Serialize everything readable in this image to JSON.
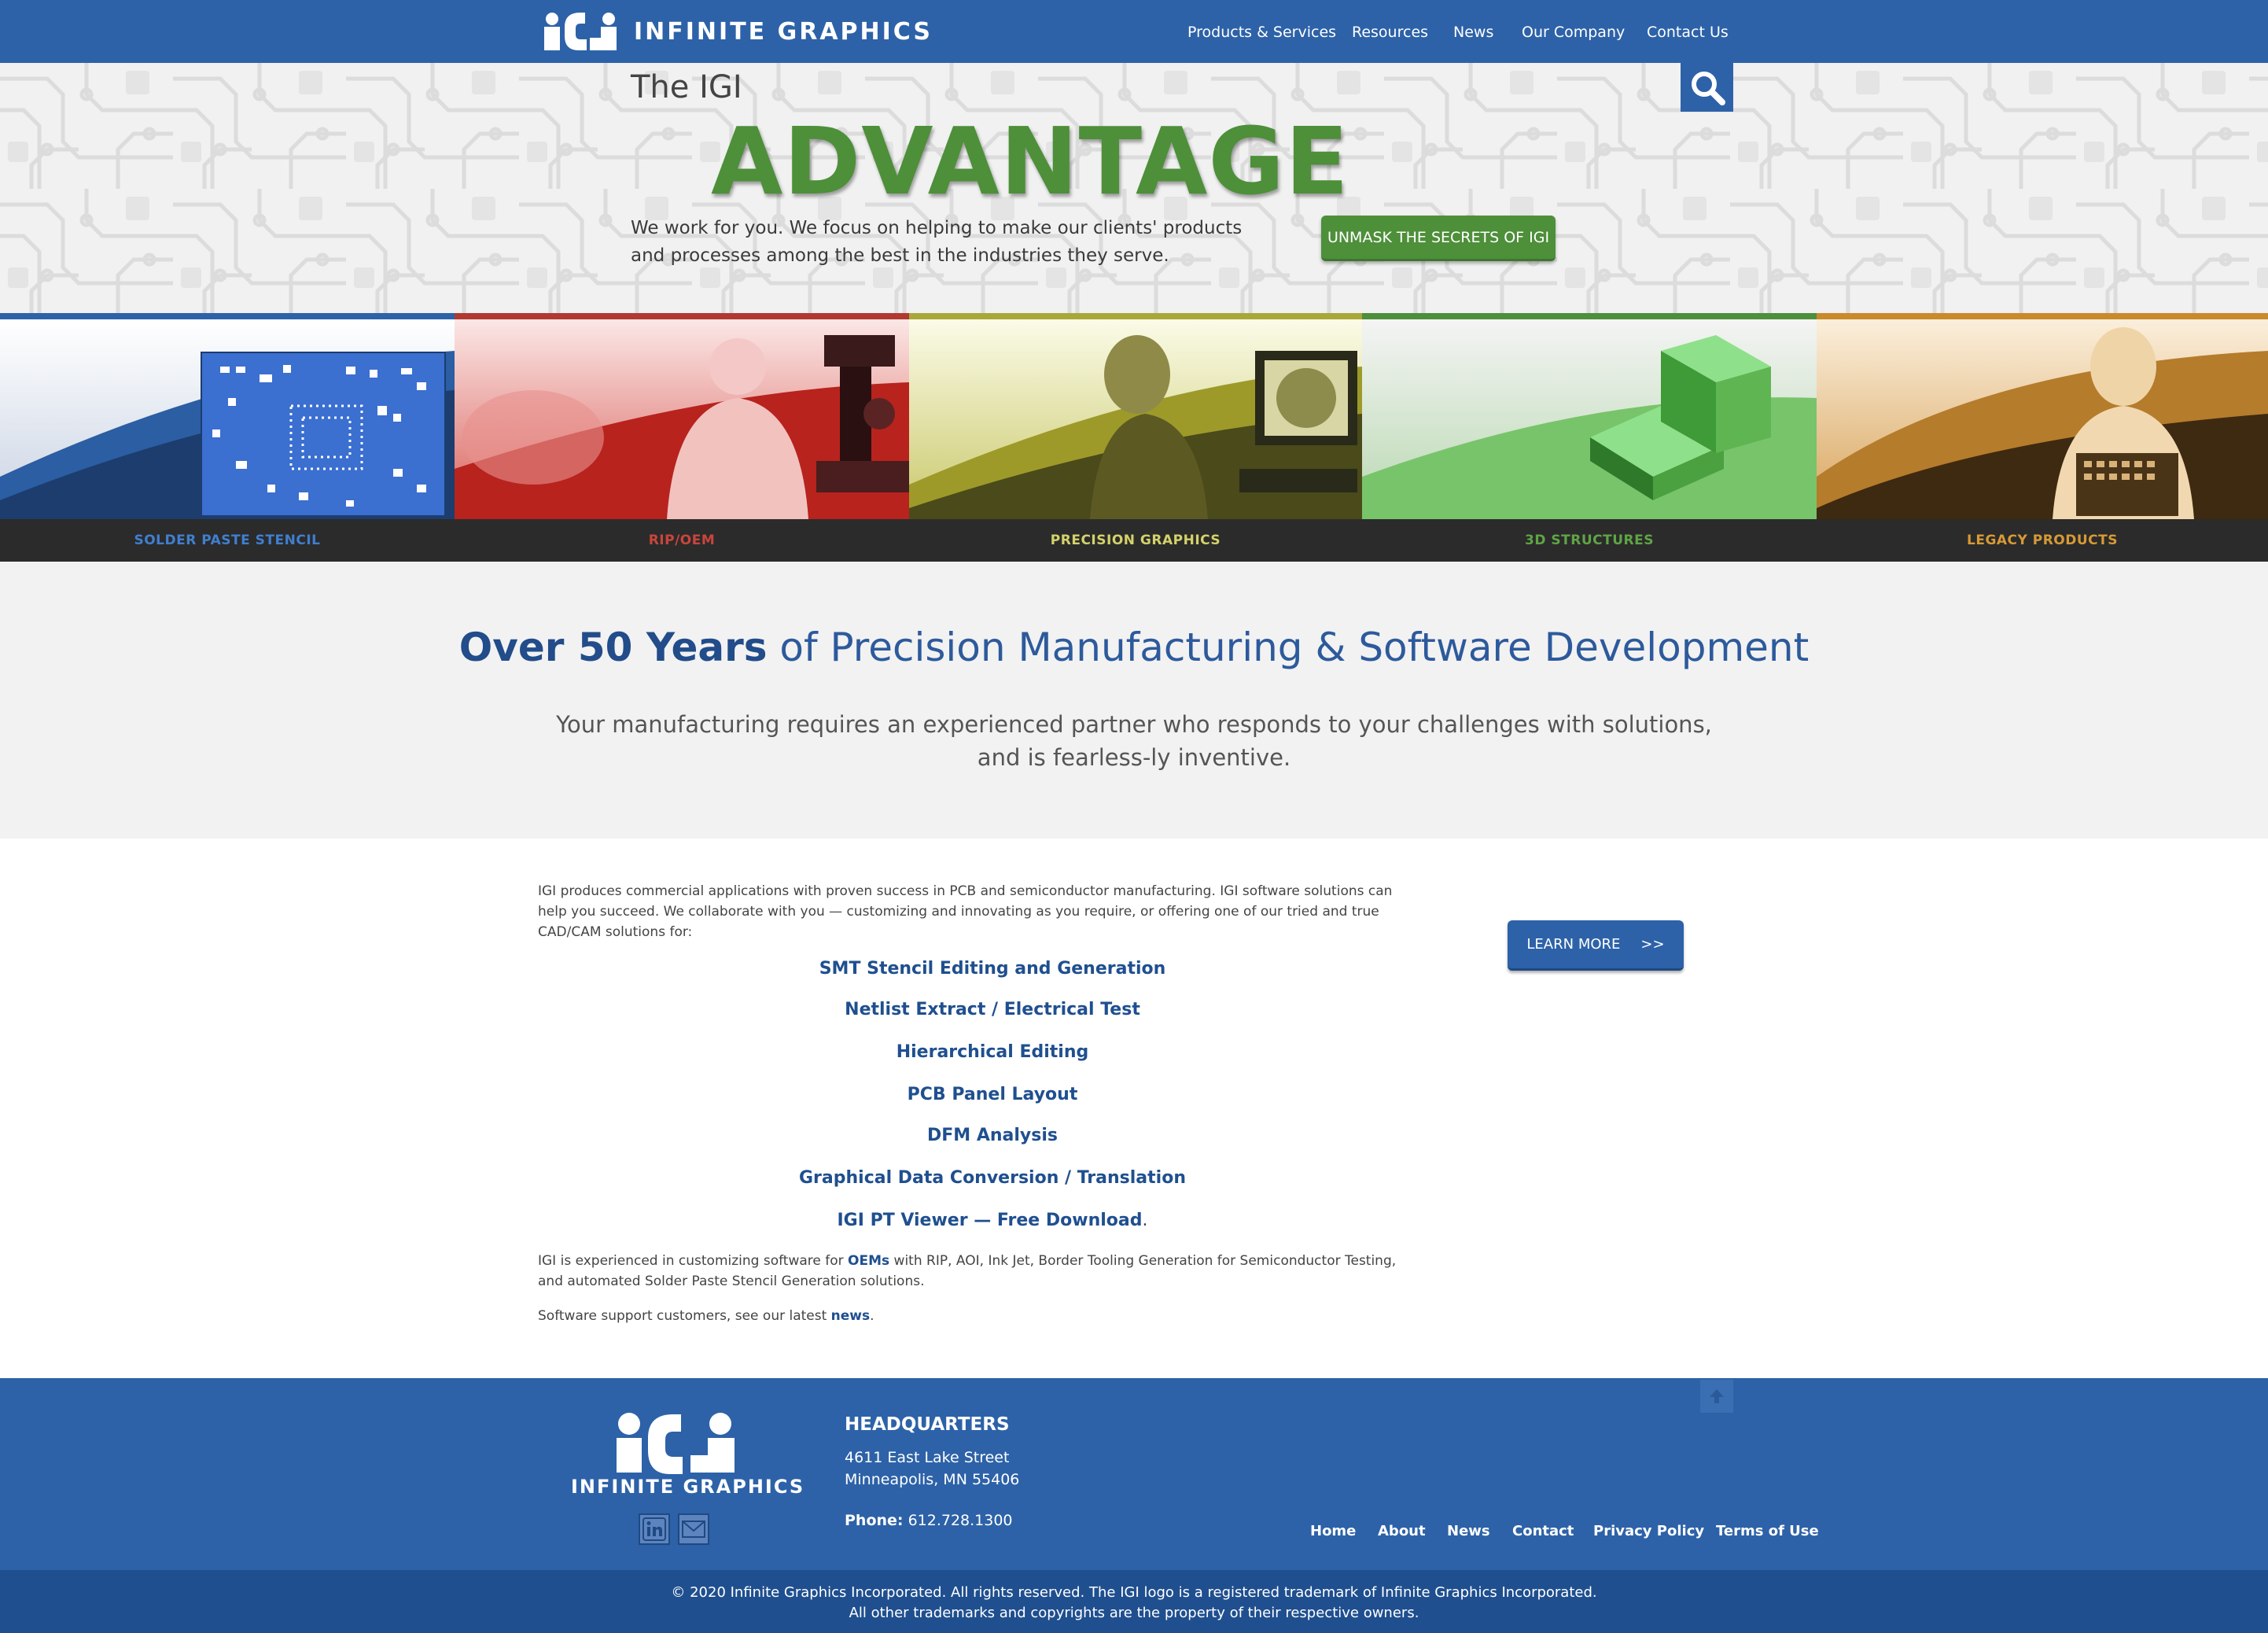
{
  "header": {
    "logo_text": "INFINITE GRAPHICS",
    "nav": [
      "Products & Services",
      "Resources",
      "News",
      "Our Company",
      "Contact Us"
    ]
  },
  "hero": {
    "small_title": "The IGI",
    "big_title": "ADVANTAGE",
    "copy": "We work for you. We focus on helping to make our clients' products and processes among the best in the industries they serve.",
    "button": "UNMASK THE SECRETS OF IGI",
    "search_icon": "search-icon"
  },
  "categories": [
    {
      "label": "SOLDER PASTE STENCIL",
      "color": "#2d62a8",
      "label_color": "#3f7fd0"
    },
    {
      "label": "RIP/OEM",
      "color": "#b03a32",
      "label_color": "#c9453c"
    },
    {
      "label": "PRECISION GRAPHICS",
      "color": "#a8a83a",
      "label_color": "#d4d26a"
    },
    {
      "label": "3D STRUCTURES",
      "color": "#4e8f3a",
      "label_color": "#5fa446"
    },
    {
      "label": "LEGACY PRODUCTS",
      "color": "#c98a2b",
      "label_color": "#d79a35"
    }
  ],
  "intro": {
    "heading_bold": "Over 50 Years",
    "heading_rest": " of Precision Manufacturing & Software Development",
    "paragraph": "Your manufacturing requires an experienced partner who responds to your challenges with solutions, and is fearless-ly inventive."
  },
  "main": {
    "intro_para": "IGI produces commercial applications with proven success in PCB and semiconductor manufacturing. IGI software solutions can help you succeed. We collaborate with you — customizing and innovating as you require, or offering one of our tried and true CAD/CAM solutions for:",
    "solutions": [
      "SMT Stencil Editing and Generation",
      "Netlist Extract / Electrical Test",
      "Hierarchical Editing",
      "PCB Panel Layout",
      "DFM Analysis",
      "Graphical Data Conversion / Translation",
      "IGI PT Viewer — Free Download"
    ],
    "period": ".",
    "oem_before": "IGI is experienced in customizing software for ",
    "oem_link": "OEMs",
    "oem_after": " with RIP, AOI, Ink Jet, Border Tooling Generation for Semiconductor Testing, and automated Solder Paste Stencil Generation solutions.",
    "support_before": "Software support customers, see our latest ",
    "support_link": "news",
    "support_after": ".",
    "learn_more": "LEARN MORE",
    "learn_more_arrows": ">>"
  },
  "footer": {
    "logo_text": "INFINITE GRAPHICS",
    "hq_title": "HEADQUARTERS",
    "address1": "4611 East Lake Street",
    "address2": "Minneapolis, MN 55406",
    "phone_label": "Phone:",
    "phone": "612.728.1300",
    "links": [
      "Home",
      "About",
      "News",
      "Contact",
      "Privacy Policy",
      "Terms of Use"
    ],
    "social_icons": [
      "linkedin-icon",
      "email-icon"
    ],
    "copyright1": "© 2020 Infinite Graphics Incorporated. All rights reserved. The IGI logo is a registered trademark of Infinite Graphics Incorporated.",
    "copyright2": "All other trademarks and copyrights are the property of their respective owners."
  }
}
